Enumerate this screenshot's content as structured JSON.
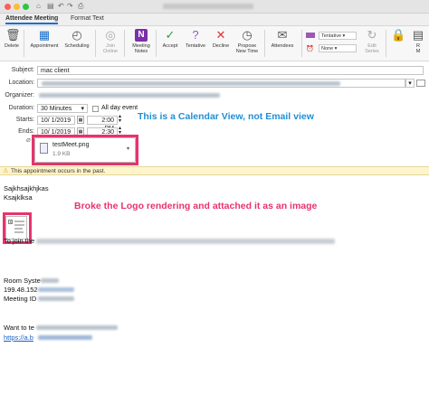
{
  "window": {
    "title": ""
  },
  "tabs": [
    {
      "label": "Attendee Meeting"
    },
    {
      "label": "Format Text"
    }
  ],
  "ribbon": {
    "delete": "Delete",
    "appointment": "Appointment",
    "scheduling": "Scheduling",
    "join_online_1": "Join",
    "join_online_2": "Online",
    "meeting_notes_1": "Meeting",
    "meeting_notes_2": "Notes",
    "accept": "Accept",
    "tentative": "Tentative",
    "decline": "Decline",
    "propose_1": "Propose",
    "propose_2": "New Time",
    "attendees": "Attendees",
    "status_value": "Tentative",
    "reminder_value": "None",
    "edit_series_1": "Edit",
    "edit_series_2": "Series",
    "more_1": "R",
    "more_2": "M"
  },
  "form": {
    "subject_label": "Subject:",
    "subject_value": "mac client",
    "location_label": "Location:",
    "organizer_label": "Organizer:",
    "duration_label": "Duration:",
    "duration_value": "30 Minutes",
    "all_day_label": "All day event",
    "starts_label": "Starts:",
    "starts_date": "10/  1/2019",
    "starts_time": "2:00 PM",
    "ends_label": "Ends:",
    "ends_date": "10/  1/2019",
    "ends_time": "2:30 PM"
  },
  "attachment": {
    "name": "testMeet.png",
    "size": "1.9 KB"
  },
  "annotations": {
    "calendar_view": "This is a Calendar View, not Email view",
    "logo_note": "Broke the Logo rendering and attached it as an image"
  },
  "infobar": {
    "text": "This appointment occurs in the past."
  },
  "body": {
    "line1": "Sajkhsajkhjkas",
    "line2": "Ksajklksa",
    "join_prefix": "To join the",
    "room_prefix": "Room Syste",
    "ip_prefix": "199.48.152",
    "meeting_id_prefix": "Meeting ID",
    "want_prefix": "Want to te",
    "link_prefix": "https://a.b"
  },
  "colors": {
    "accent": "#1a6fc9",
    "annotation_blue": "#1e8fd6",
    "annotation_pink": "#e8336d",
    "infobar": "#fff5cc"
  }
}
